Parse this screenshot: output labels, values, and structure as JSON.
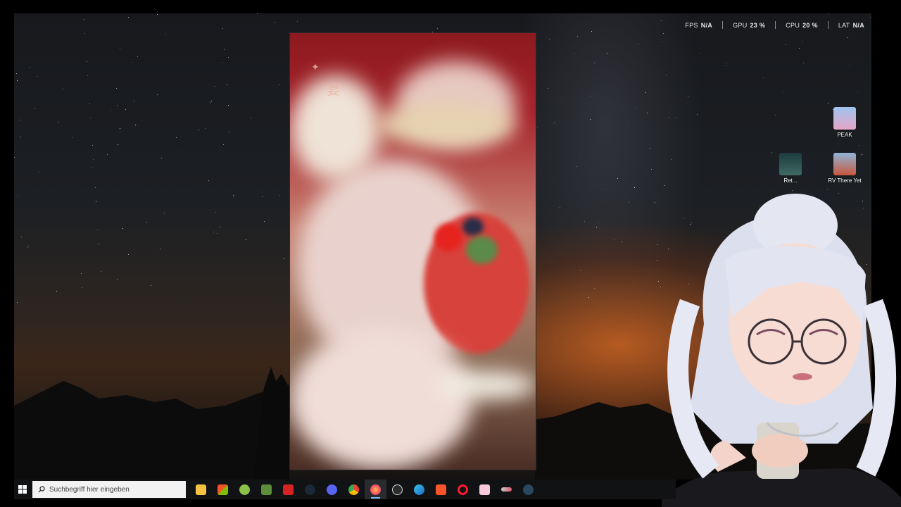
{
  "overlay": {
    "fps_label": "FPS",
    "fps_value": "N/A",
    "gpu_label": "GPU",
    "gpu_value": "23 %",
    "cpu_label": "CPU",
    "cpu_value": "20 %",
    "lat_label": "LAT",
    "lat_value": "N/A"
  },
  "desktop_icons": {
    "peak": "PEAK",
    "retouch": "Ret...",
    "rv": "RV There Yet"
  },
  "taskbar": {
    "search_placeholder": "Suchbegriff hier eingeben",
    "apps": [
      "file-explorer",
      "microsoft-store",
      "android",
      "minecraft",
      "news-app",
      "steam",
      "discord",
      "chrome",
      "firefox",
      "obs",
      "edge-alt",
      "brave",
      "opera",
      "pink-app",
      "launcher",
      "steam-2"
    ]
  },
  "video": {
    "glyph": "宴"
  },
  "colors": {
    "accent": "#7fb6f0",
    "taskbar": "#111214"
  }
}
